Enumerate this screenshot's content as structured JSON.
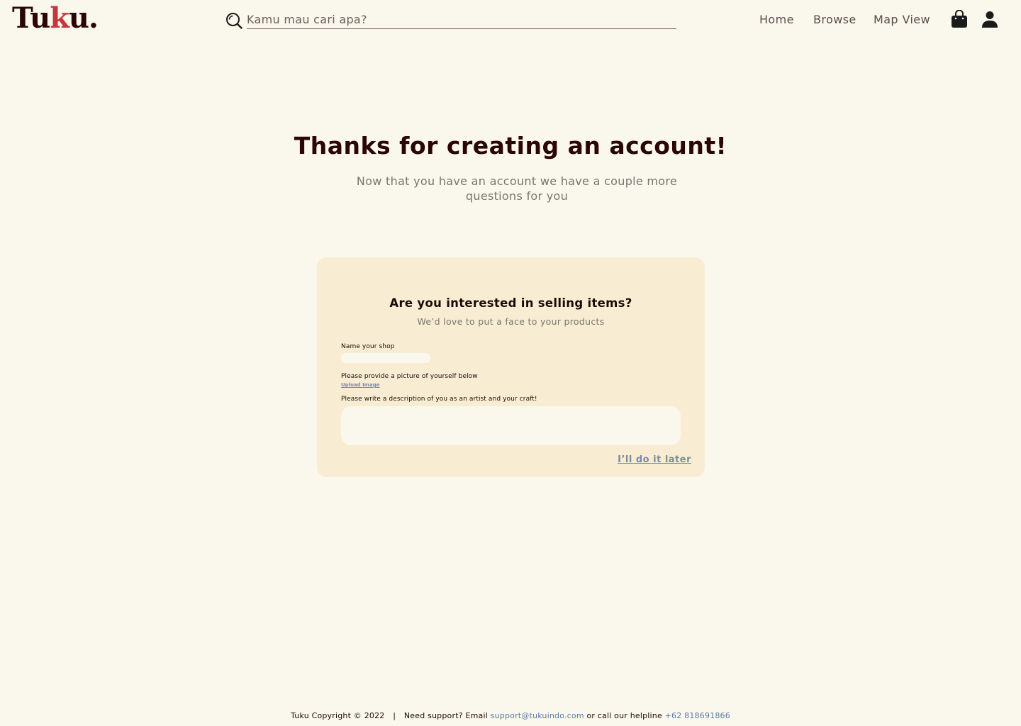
{
  "header": {
    "logo": {
      "prefix": "Tu",
      "accent": "k",
      "suffix": "u."
    },
    "search": {
      "placeholder": "Kamu mau cari apa?"
    },
    "nav": {
      "home": "Home",
      "browse": "Browse",
      "map_view": "Map View"
    },
    "icons": {
      "search": "search-icon",
      "bag": "shopping-bag-icon",
      "user": "user-icon"
    }
  },
  "hero": {
    "title": "Thanks for creating an account!",
    "subtitle": "Now that you have an account we have a couple more questions for you"
  },
  "card": {
    "title": "Are you interested in selling items?",
    "subtitle": "We’d love to put a face to your products",
    "shop_label": "Name your shop",
    "picture_label": "Please provide a picture of yourself below",
    "upload_link": "Upload Image",
    "description_label": "Please write a description of you as an artist and your craft!",
    "later_link": "I’ll do it later"
  },
  "footer": {
    "copyright": "Tuku Copyright © 2022",
    "separator": "|",
    "support_prefix": "Need support? Email",
    "email": "support@tukuindo.com",
    "helpline_prefix": "or call our helpline",
    "phone": "+62 818691866"
  },
  "colors": {
    "background": "#faf7ec",
    "card": "#f8edd2",
    "brand": "#2a0605",
    "accent": "#c8353a",
    "link": "#7a8aa5"
  }
}
